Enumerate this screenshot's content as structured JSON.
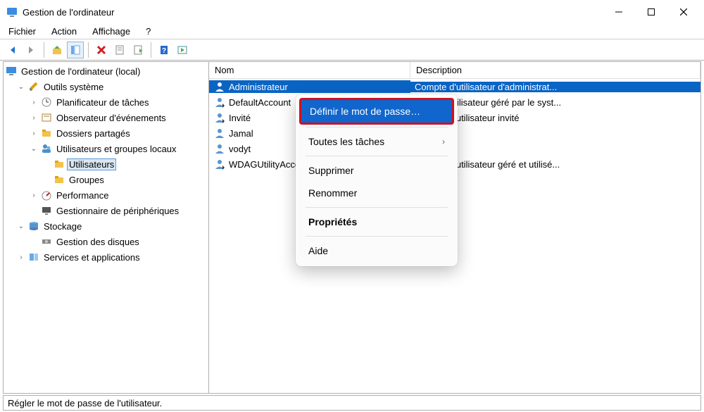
{
  "window": {
    "title": "Gestion de l'ordinateur"
  },
  "menubar": {
    "items": [
      "Fichier",
      "Action",
      "Affichage",
      "?"
    ]
  },
  "tree": {
    "root": "Gestion de l'ordinateur (local)",
    "items": {
      "outils": "Outils système",
      "planificateur": "Planificateur de tâches",
      "observateur": "Observateur d'événements",
      "dossiers": "Dossiers partagés",
      "usersgroups": "Utilisateurs et groupes locaux",
      "utilisateurs": "Utilisateurs",
      "groupes": "Groupes",
      "performance": "Performance",
      "devices": "Gestionnaire de périphériques",
      "stockage": "Stockage",
      "disques": "Gestion des disques",
      "services": "Services et applications"
    }
  },
  "list": {
    "columns": {
      "name": "Nom",
      "description": "Description"
    },
    "rows": [
      {
        "name": "Administrateur",
        "description": "Compte d'utilisateur d'administrat..."
      },
      {
        "name": "DefaultAccount",
        "description": "Compte utilisateur géré par le syst..."
      },
      {
        "name": "Invité",
        "description": "Compte d'utilisateur invité"
      },
      {
        "name": "Jamal",
        "description": ""
      },
      {
        "name": "vodyt",
        "description": ""
      },
      {
        "name": "WDAGUtilityAccount",
        "description": "Compte d'utilisateur géré et utilisé..."
      }
    ]
  },
  "context_menu": {
    "items": {
      "set_password": "Définir le mot de passe…",
      "all_tasks": "Toutes les tâches",
      "delete": "Supprimer",
      "rename": "Renommer",
      "properties": "Propriétés",
      "help": "Aide"
    }
  },
  "statusbar": {
    "text": "Régler le mot de passe de l'utilisateur."
  }
}
